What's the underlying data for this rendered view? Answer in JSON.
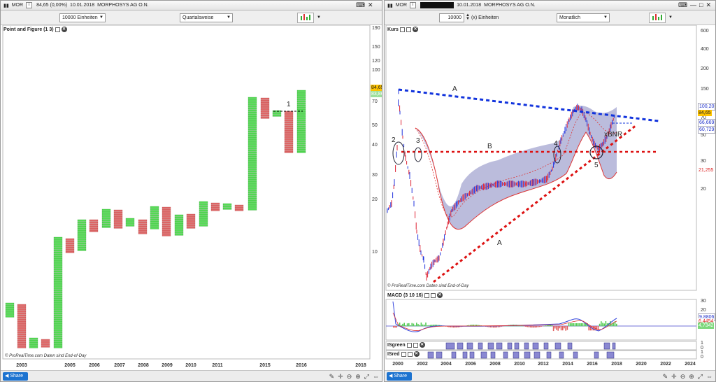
{
  "left_window": {
    "title": {
      "symbol": "MOR",
      "price": "84,65 (0,00%)",
      "date": "10.01.2018",
      "name": "MORPHOSYS AG O.N."
    },
    "toolbar": {
      "units": "10000 Einheiten",
      "period": "Quartalsweise"
    },
    "panel_label": "Point and Figure (1 3)",
    "y_ticks": [
      "190",
      "150",
      "120",
      "100",
      "70",
      "50",
      "40",
      "30",
      "20",
      "10"
    ],
    "price_tags": {
      "last": "84,65",
      "prev": "83,86"
    },
    "x_ticks": [
      "2003",
      "2005",
      "2006",
      "2007",
      "2008",
      "2009",
      "2010",
      "2011",
      "2015",
      "2016",
      "2018"
    ],
    "annotation": "1",
    "credit": "© ProRealTime.com  Daten sind End-of-Day",
    "share": "Share"
  },
  "right_window": {
    "title": {
      "symbol": "MOR",
      "date": "10.01.2018",
      "name": "MORPHOSYS AG O.N."
    },
    "toolbar": {
      "units_value": "10000",
      "units_label": "(x) Einheiten",
      "period": "Monatlich"
    },
    "panels": {
      "price": "Kurs",
      "macd": "MACD (3 10 16)",
      "isgreen": "ISgreen",
      "isred": "ISred"
    },
    "y_ticks": [
      "600",
      "400",
      "200",
      "150",
      "100",
      "70",
      "50",
      "30",
      "20"
    ],
    "price_tags": {
      "t1": "100,20",
      "t2": "84,65",
      "t3": "66,669",
      "t4": "60,729",
      "t5": "21,255"
    },
    "macd_ticks": [
      "30",
      "20",
      "10",
      "0"
    ],
    "macd_tags": {
      "a": "9,8806",
      "b": "6,4454",
      "c": "4,7342"
    },
    "is_ticks": [
      "1",
      "0",
      "1",
      "0"
    ],
    "x_ticks": [
      "2000",
      "2002",
      "2004",
      "2006",
      "2008",
      "2010",
      "2012",
      "2014",
      "2016",
      "2018",
      "2020",
      "2022",
      "2024"
    ],
    "annotations": {
      "A_top": "A",
      "A_bottom": "A",
      "B": "B",
      "n2": "2",
      "n3": "3",
      "n4": "4",
      "n5": "5",
      "label": "xBNR"
    },
    "credit": "© ProRealTime.com  Daten sind End-of-Day",
    "share": "Share"
  },
  "colors": {
    "x_col": "#55dd55",
    "o_col": "#e06868",
    "blue": "#2233cc",
    "red": "#dd2222"
  }
}
